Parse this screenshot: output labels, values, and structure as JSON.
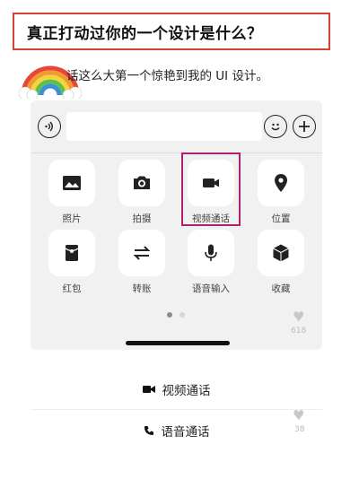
{
  "title": "真正打动过你的一个设计是什么？",
  "subtitle": "话这么大第一个惊艳到我的 UI 设计。",
  "input_bar": {
    "voice_icon": "voice-icon",
    "text_value": "",
    "emoji_icon": "emoji-icon",
    "plus_icon": "plus-icon"
  },
  "panel": {
    "items": [
      {
        "label": "照片",
        "icon": "image-icon"
      },
      {
        "label": "拍摄",
        "icon": "camera-icon"
      },
      {
        "label": "视频通话",
        "icon": "video-camera-icon",
        "highlighted": true
      },
      {
        "label": "位置",
        "icon": "location-pin-icon"
      },
      {
        "label": "红包",
        "icon": "red-envelope-icon"
      },
      {
        "label": "转账",
        "icon": "transfer-icon"
      },
      {
        "label": "语音输入",
        "icon": "microphone-icon"
      },
      {
        "label": "收藏",
        "icon": "favorites-cube-icon"
      }
    ],
    "page_dots": {
      "total": 2,
      "active": 1
    }
  },
  "side_counts": {
    "first": "618",
    "second": "38"
  },
  "sheet": {
    "video_call_label": "视频通话",
    "voice_call_label": "语音通话"
  },
  "colors": {
    "title_border": "#d9402f",
    "highlight_border": "#b0206e"
  }
}
